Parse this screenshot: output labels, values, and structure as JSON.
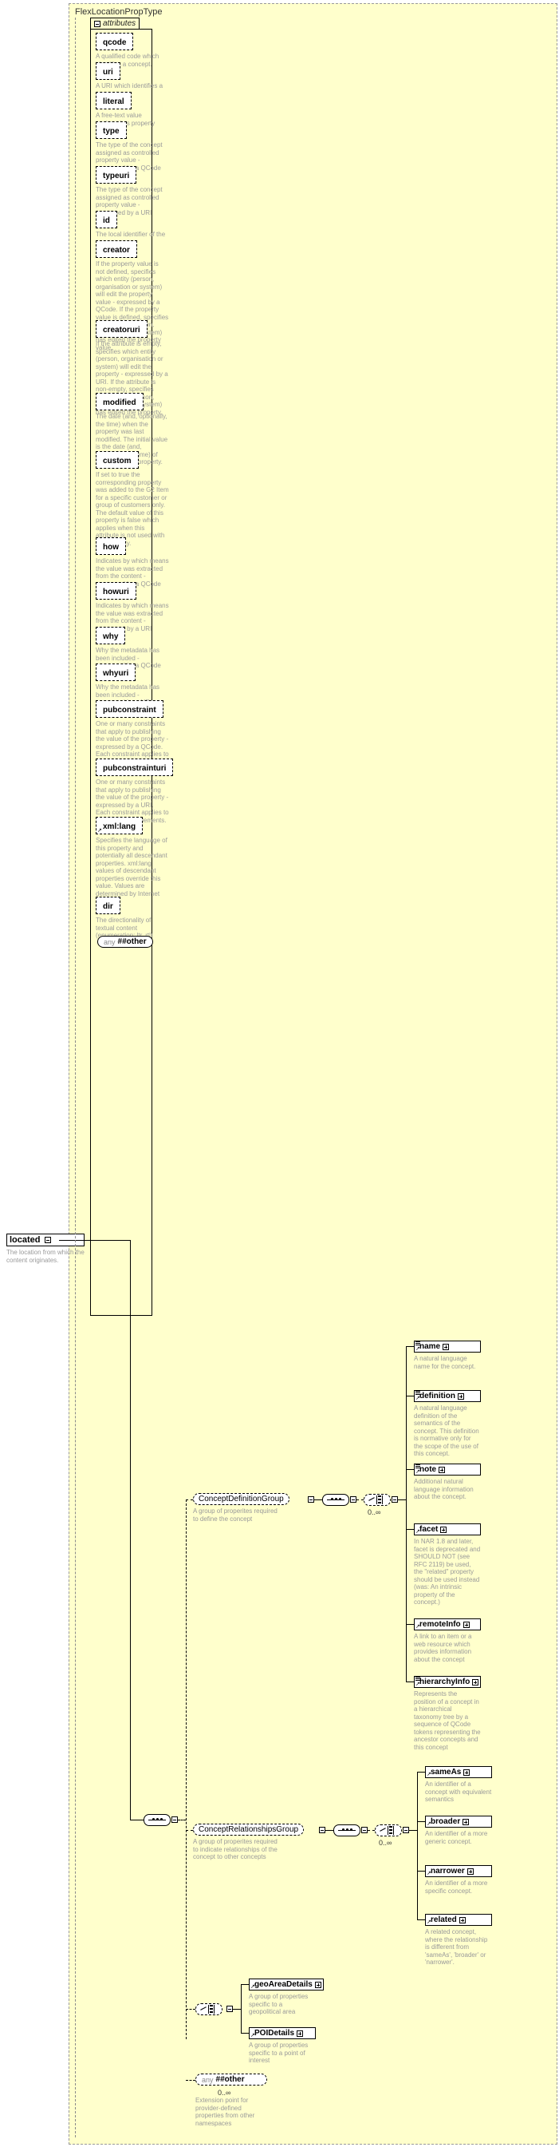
{
  "diagram": {
    "type_name": "FlexLocationPropType",
    "attributes_label": "attributes",
    "background_color": "#ffffcc"
  },
  "root_element": {
    "name": "located",
    "doc": "The location from which the content originates."
  },
  "attributes": [
    {
      "name": "qcode",
      "doc": "A qualified code which identifies a concept."
    },
    {
      "name": "uri",
      "doc": "A URI which identifies a concept."
    },
    {
      "name": "literal",
      "doc": "A free-text value assigned as property value."
    },
    {
      "name": "type",
      "doc": "The type of the concept assigned as controlled property value - expressed by a QCode"
    },
    {
      "name": "typeuri",
      "doc": "The type of the concept assigned as controlled property value - expressed by a URI"
    },
    {
      "name": "id",
      "doc": "The local identifier of the property."
    },
    {
      "name": "creator",
      "doc": "If the property value is not defined, specifies which entity (person, organisation or system) will edit the property value - expressed by a QCode. If the property value is defined, specifies which entity (person, organisation or system) has edited the property value."
    },
    {
      "name": "creatoruri",
      "doc": "If the attribute is empty, specifies which entity (person, organisation or system) will edit the property - expressed by a URI. If the attribute is non-empty, specifies which entity (person, organisation or system) has edited the property."
    },
    {
      "name": "modified",
      "doc": "The date (and, optionally, the time) when the property was last modified. The initial value is the date (and, optionally, the time) of creation of the property."
    },
    {
      "name": "custom",
      "doc": "If set to true the corresponding property was added to the G2 Item for a specific customer or group of customers only. The default value of this property is false which applies when this attribute is not used with the property."
    },
    {
      "name": "how",
      "doc": "Indicates by which means the value was extracted from the content - expressed by a QCode"
    },
    {
      "name": "howuri",
      "doc": "Indicates by which means the value was extracted from the content - expressed by a URI"
    },
    {
      "name": "why",
      "doc": "Why the metadata has been included - expressed by a QCode"
    },
    {
      "name": "whyuri",
      "doc": "Why the metadata has been included - expressed by a URI"
    },
    {
      "name": "pubconstraint",
      "doc": "One or many constraints that apply to publishing the value of the property - expressed by a QCode. Each constraint applies to all descendant elements."
    },
    {
      "name": "pubconstrainturi",
      "doc": "One or many constraints that apply to publishing the value of the property - expressed by a URI. Each constraint applies to all descendant elements."
    },
    {
      "name": "xml:lang",
      "doc": "Specifies the language of this property and potentially all descendant properties. xml:lang values of descendant properties override this value. Values are determined by Internet BCP 47."
    },
    {
      "name": "dir",
      "doc": "The directionality of textual content (enumeration: ltr, rtl)"
    }
  ],
  "attributes_any": {
    "any_label": "any",
    "namespace": "##other"
  },
  "concept_definition_group": {
    "name": "ConceptDefinitionGroup",
    "doc": "A group of properites required to define the concept",
    "occurs": "0..∞",
    "children": [
      {
        "name": "name",
        "doc": "A natural language name for the concept.",
        "has_seq_icon": true
      },
      {
        "name": "definition",
        "doc": "A natural language definition of the semantics of the concept. This definition is normative only for the scope of the use of this concept.",
        "has_seq_icon": true
      },
      {
        "name": "note",
        "doc": "Additional natural language information about the concept.",
        "has_seq_icon": true
      },
      {
        "name": "facet",
        "doc": "In NAR 1.8 and later, facet is deprecated and SHOULD NOT (see RFC 2119) be used, the \"related\" property should be used instead (was: An intrinsic property of the concept.)",
        "has_seq_icon": false
      },
      {
        "name": "remoteInfo",
        "doc": "A link to an item or a web resource which provides information about the concept",
        "has_seq_icon": false
      },
      {
        "name": "hierarchyInfo",
        "doc": "Represents the position of a concept in a hierarchical taxonomy tree by a sequence of QCode tokens representing the ancestor concepts and this concept",
        "has_seq_icon": true
      }
    ]
  },
  "concept_relationships_group": {
    "name": "ConceptRelationshipsGroup",
    "doc": "A group of properites required to indicate relationships of the concept to other concepts",
    "occurs": "0..∞",
    "children": [
      {
        "name": "sameAs",
        "doc": "An identifier of a concept with equivalent semantics",
        "has_seq_icon": false
      },
      {
        "name": "broader",
        "doc": "An identifier of a more generic concept.",
        "has_seq_icon": false
      },
      {
        "name": "narrower",
        "doc": "An identifier of a more specific concept.",
        "has_seq_icon": false
      },
      {
        "name": "related",
        "doc": "A related concept, where the relationship is different from 'sameAs', 'broader' or 'narrower'.",
        "has_seq_icon": false
      }
    ]
  },
  "details_choice": {
    "children": [
      {
        "name": "geoAreaDetails",
        "doc": "A group of properties specific to a geopolitical area",
        "has_seq_icon": false
      },
      {
        "name": "POIDetails",
        "doc": "A group of properties specific to a point of interest",
        "has_seq_icon": false
      }
    ]
  },
  "content_any": {
    "any_label": "any",
    "namespace": "##other",
    "occurs": "0..∞",
    "doc": "Extension point for provider-defined properties from other namespaces"
  }
}
